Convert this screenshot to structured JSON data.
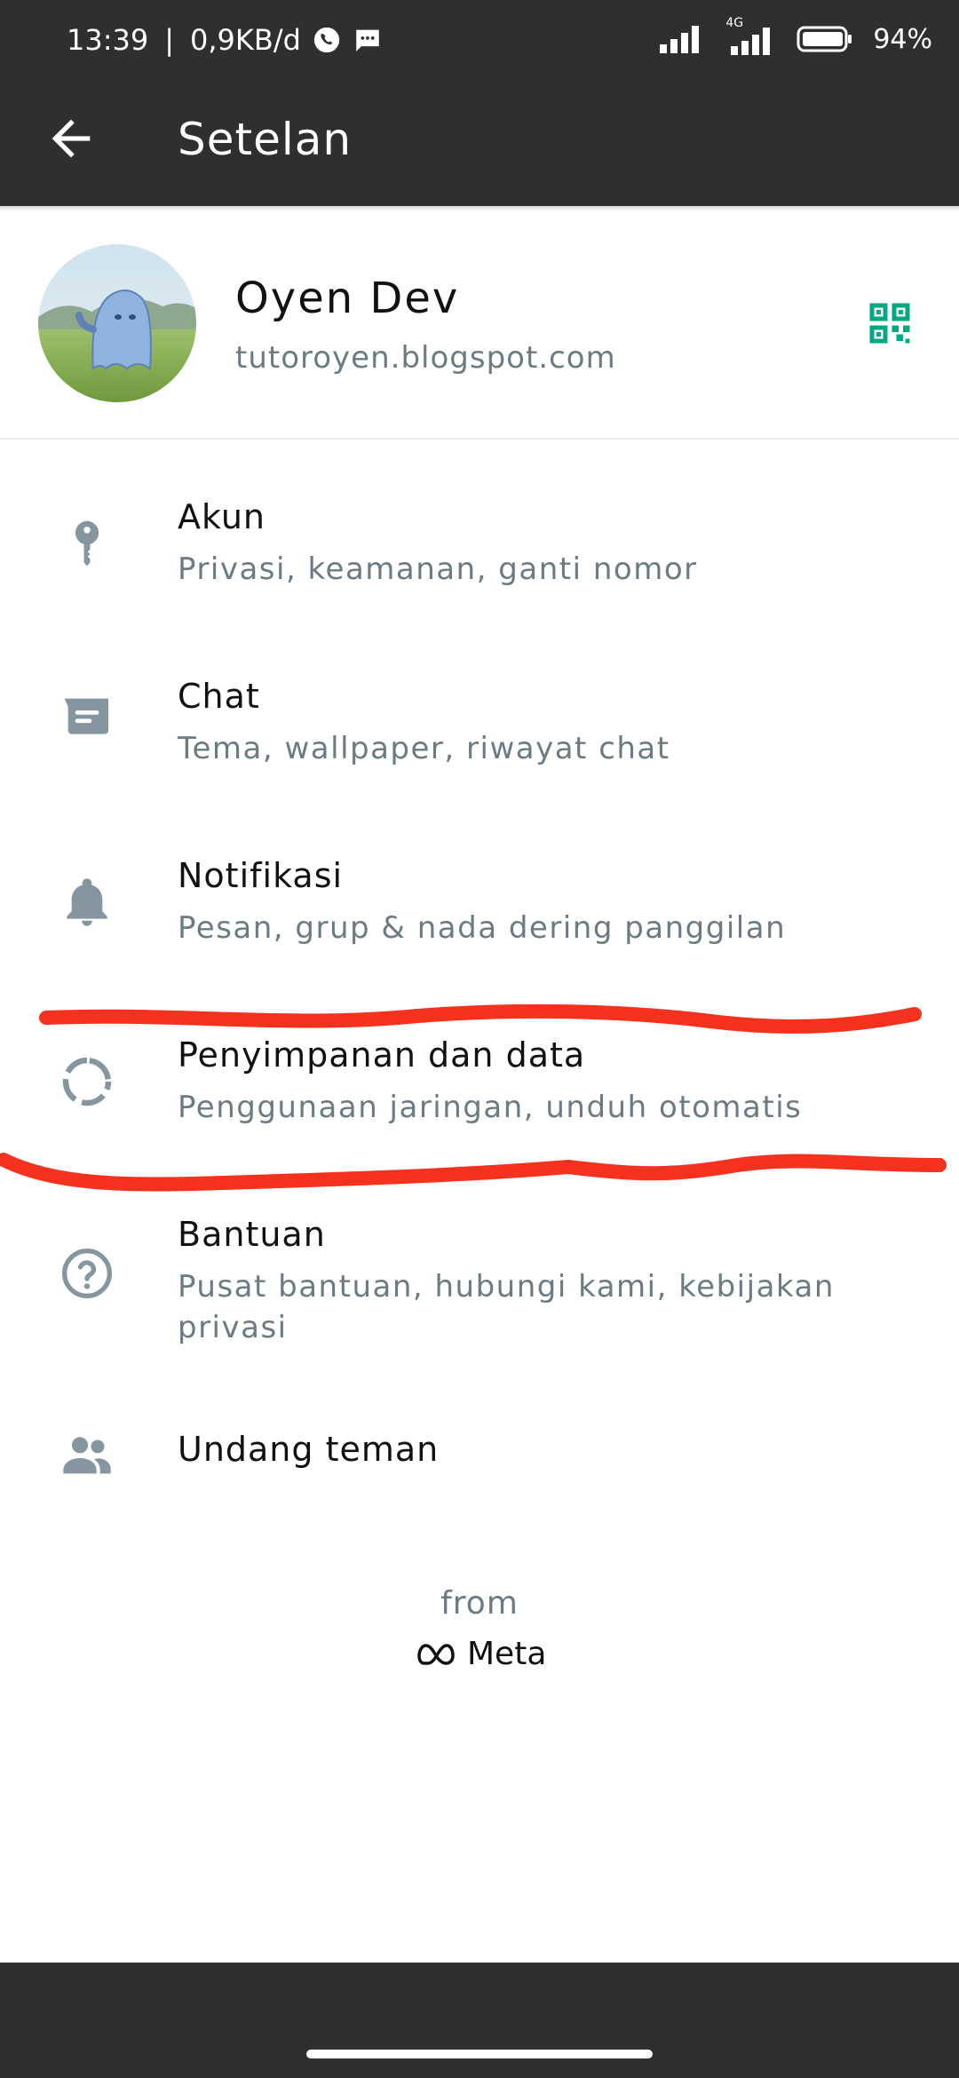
{
  "status_bar": {
    "time": "13:39",
    "separator": "|",
    "data_speed": "0,9KB/d",
    "network": "4G",
    "battery": "94%"
  },
  "app_bar": {
    "title": "Setelan",
    "back_icon": "arrow-left-icon"
  },
  "profile": {
    "name": "Oyen Dev",
    "status": "tutoroyen.blogspot.com",
    "qr_icon": "qr-code-icon"
  },
  "settings": [
    {
      "title": "Akun",
      "subtitle": "Privasi, keamanan, ganti nomor",
      "icon": "key-icon"
    },
    {
      "title": "Chat",
      "subtitle": "Tema, wallpaper, riwayat chat",
      "icon": "chat-icon"
    },
    {
      "title": "Notifikasi",
      "subtitle": "Pesan, grup & nada dering panggilan",
      "icon": "bell-icon"
    },
    {
      "title": "Penyimpanan dan data",
      "subtitle": "Penggunaan jaringan, unduh otomatis",
      "icon": "storage-icon"
    },
    {
      "title": "Bantuan",
      "subtitle": "Pusat bantuan, hubungi kami, kebijakan privasi",
      "icon": "help-icon"
    },
    {
      "title": "Undang teman",
      "subtitle": "",
      "icon": "people-icon"
    }
  ],
  "footer": {
    "from": "from",
    "brand": "Meta"
  },
  "colors": {
    "appbar": "#2f2f2f",
    "accent": "#00a884",
    "icon_gray": "#8696a0",
    "annotation_red": "#f5321e"
  }
}
